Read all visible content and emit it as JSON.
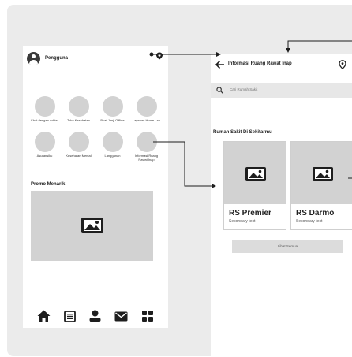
{
  "home": {
    "user_label": "Pengguna",
    "services": [
      {
        "label": "Chat dengan dokter"
      },
      {
        "label": "Toko Kesehatan"
      },
      {
        "label": "Buat Janji Offline"
      },
      {
        "label": "Layanan Home Lab"
      },
      {
        "label": "Asuransiku"
      },
      {
        "label": "Kesehatan Mental"
      },
      {
        "label": "Langganan"
      },
      {
        "label": "Informasi Ruang Rawat Inap"
      }
    ],
    "promo_title": "Promo Menarik",
    "nav": [
      {
        "icon": "home-icon"
      },
      {
        "icon": "document-icon"
      },
      {
        "icon": "profile-icon"
      },
      {
        "icon": "mail-icon"
      },
      {
        "icon": "grid-icon"
      }
    ]
  },
  "detail": {
    "title": "Informasi Ruang Rawat Inap",
    "search_placeholder": "Cari Rumah Sakit",
    "section_title": "Rumah Sakit Di Sekitarmu",
    "cards": [
      {
        "name": "RS Premier",
        "sub": "Secondary text"
      },
      {
        "name": "RS Darmo",
        "sub": "Secondary text"
      }
    ],
    "see_all_label": "Lihat Semua"
  },
  "colors": {
    "canvas": "#ebebeb",
    "placeholder": "#d2d2d2",
    "icon": "#1e1e1e"
  }
}
